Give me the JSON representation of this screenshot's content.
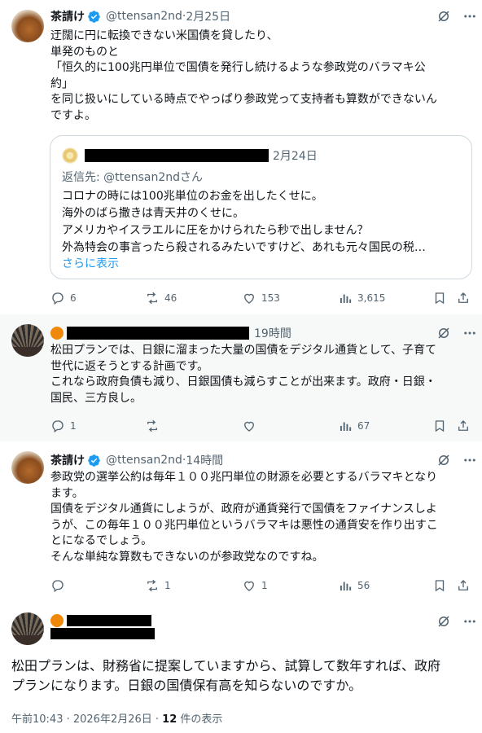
{
  "post1": {
    "name": "茶請け",
    "handle": "@ttensan2nd",
    "sep": " · ",
    "date": "2月25日",
    "text": "迂闊に円に転換できない米国債を貸したり、\n単発のものと\n「恒久的に100兆円単位で国債を発行し続けるような参政党のバラマキ公\n約」\nを同じ扱いにしている時点でやっぱり参政党って支持者も算数ができないん\nですよ。",
    "quote": {
      "date": "2月24日",
      "reply_to": "返信先: @ttensan2ndさん",
      "text": "コロナの時には100兆単位のお金を出したくせに。\n海外のばら撒きは青天井のくせに。\nアメリカやイスラエルに圧をかけられたら秒で出しません？\n外為特会の事言ったら殺されるみたいですけど、あれも元々国民の税…",
      "more": "さらに表示"
    },
    "actions": {
      "reply": "6",
      "repost": "46",
      "like": "153",
      "views": "3,615"
    }
  },
  "post2": {
    "date": "19時間",
    "text": "松田プランでは、日銀に溜まった大量の国債をデジタル通貨として、子育て\n世代に返そうとする計画です。\nこれなら政府負債も減り、日銀国債も減らすことが出来ます。政府・日銀・\n国民、三方良し。",
    "actions": {
      "reply": "1",
      "repost": "",
      "like": "",
      "views": "67"
    }
  },
  "post3": {
    "name": "茶請け",
    "handle": "@ttensan2nd",
    "sep": " · ",
    "date": "14時間",
    "text": "参政党の選挙公約は毎年１００兆円単位の財源を必要とするバラマキとなり\nます。\n国債をデジタル通貨にしようが、政府が通貨発行で国債をファイナンスしよ\nうが、この毎年１００兆円単位というバラマキは悪性の通貨安を作り出すこ\nとになるでしょう。\nそんな単純な算数もできないのが参政党なのですね。",
    "actions": {
      "reply": "",
      "repost": "1",
      "like": "1",
      "views": "56"
    }
  },
  "post4": {
    "text": "松田プランは、財務省に提案していますから、試算して数年すれば、政府\nプランになります。日銀の国債保有高を知らないのですか。",
    "time": "午前10:43 · 2026年2月26日 · ",
    "views_count": "12",
    "views_label": " 件の表示"
  },
  "colors": {
    "accent": "#1d9bf0",
    "muted": "#536471",
    "badge": "#f0890a"
  }
}
